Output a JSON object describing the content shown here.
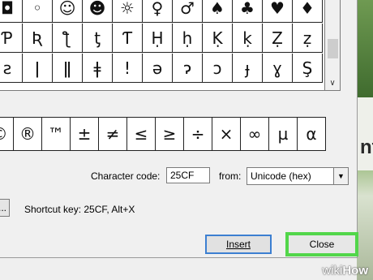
{
  "character_grid": {
    "rows": [
      [
        "◘",
        "◦",
        "☺",
        "☻",
        "☼",
        "♀",
        "♂",
        "♠",
        "♣",
        "♥",
        "♦"
      ],
      [
        "Ƥ",
        "Ʀ",
        "ƪ",
        "ƫ",
        "Ƭ",
        "Ḥ",
        "ḥ",
        "Ḳ",
        "ḳ",
        "Ẓ",
        "ẓ"
      ],
      [
        "ƨ",
        "ǀ",
        "ǁ",
        "ǂ",
        "ǃ",
        "ǝ",
        "ɂ",
        "ɔ",
        "ɟ",
        "ɣ",
        "Ş"
      ]
    ]
  },
  "recent_characters": [
    "©",
    "®",
    "™",
    "±",
    "≠",
    "≤",
    "≥",
    "÷",
    "×",
    "∞",
    "µ",
    "α"
  ],
  "character_code": {
    "label": "Character code:",
    "value": "25CF"
  },
  "from": {
    "label": "from:",
    "selected": "Unicode (hex)"
  },
  "shortcut": {
    "button_label": "...",
    "text": "Shortcut key: 25CF, Alt+X"
  },
  "buttons": {
    "insert": "Insert",
    "close": "Close"
  },
  "watermark": {
    "wiki": "wiki",
    "how": "How"
  },
  "background_text": "nt",
  "colors": {
    "highlight": "#52d64a",
    "insert_border": "#3c7fd1"
  }
}
